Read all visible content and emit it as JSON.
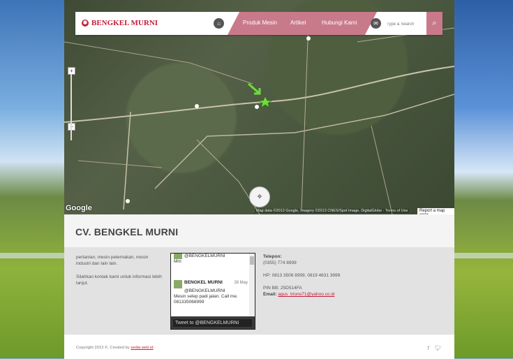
{
  "nav": {
    "brand": "BENGKEL MURNI",
    "items": [
      "Produk Mesin",
      "Artikel",
      "Hubungi Kami"
    ],
    "search_placeholder": "Type & Search",
    "accent": "#c97a8a",
    "brand_color": "#c41d3a"
  },
  "map": {
    "google_label": "Google",
    "attribution": "Map data ©2013 Google, Imagery ©2013 CNES/Spot Image, DigitalGlobe · Terms of Use",
    "report": "Report a map error",
    "zoom_in": "+",
    "zoom_out": "−"
  },
  "page_title": "CV. BENGKEL MURNI",
  "about": {
    "p1": "pertanian, mesin peternakan, mesin industri dan lain lain.",
    "p2": "Silahkan kontak kami untuk informasi lebih lanjut."
  },
  "twitter": {
    "tweet1_handle": "@BENGKELMURNI",
    "tweet1_text": "Mm",
    "tweet2_name": "BENGKEL MURNI",
    "tweet2_date": "28 May",
    "tweet2_handle": "@BENGKELMURNI",
    "tweet2_text": "Mesin selep padi jalan. Call me. 081335068999",
    "button": "Tweet to @BENGKELMURNI"
  },
  "contact": {
    "phone_label": "Telepon:",
    "phone": "(0355) 774 8999",
    "hp": "HP: 0813 3506 8999, 0819 4631 3999",
    "pin": "PIN BB: 25D514FA",
    "email_label": "Email:",
    "email": "agus_triono71@yahoo.co.id"
  },
  "footer": {
    "copyright": "Copyright 2013 ©, Created by",
    "credit": "sedia.web.id"
  }
}
